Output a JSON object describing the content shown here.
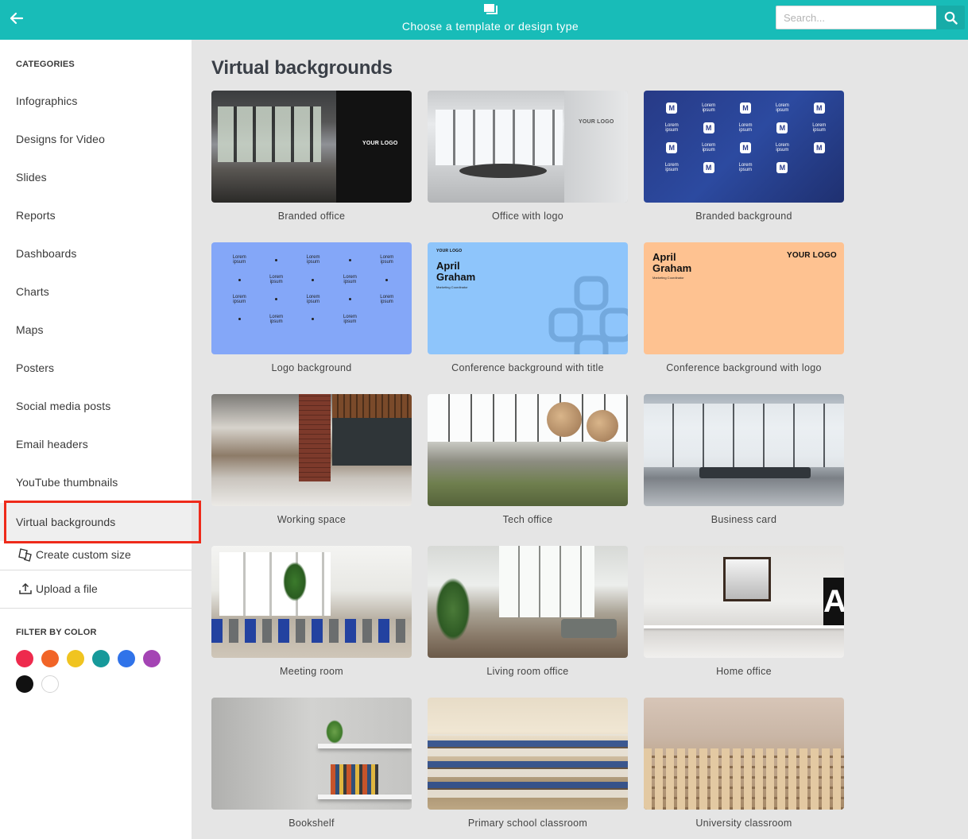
{
  "header": {
    "title": "Choose a template or design type",
    "search_placeholder": "Search..."
  },
  "sidebar": {
    "categories_title": "CATEGORIES",
    "categories": [
      {
        "label": "Infographics"
      },
      {
        "label": "Designs for Video"
      },
      {
        "label": "Slides"
      },
      {
        "label": "Reports"
      },
      {
        "label": "Dashboards"
      },
      {
        "label": "Charts"
      },
      {
        "label": "Maps"
      },
      {
        "label": "Posters"
      },
      {
        "label": "Social media posts"
      },
      {
        "label": "Email headers"
      },
      {
        "label": "YouTube thumbnails"
      },
      {
        "label": "Virtual backgrounds",
        "active": true
      }
    ],
    "actions": {
      "custom_size": "Create custom size",
      "upload": "Upload a file"
    },
    "filter_title": "FILTER BY COLOR",
    "colors": [
      "#ee2a4d",
      "#f16427",
      "#f0c420",
      "#16999a",
      "#3073e9",
      "#a444b4",
      "#111111",
      "#ffffff"
    ]
  },
  "main": {
    "title": "Virtual backgrounds",
    "templates": [
      {
        "label": "Branded office"
      },
      {
        "label": "Office with logo"
      },
      {
        "label": "Branded background"
      },
      {
        "label": "Logo background"
      },
      {
        "label": "Conference background with title"
      },
      {
        "label": "Conference background with logo"
      },
      {
        "label": "Working space"
      },
      {
        "label": "Tech office"
      },
      {
        "label": "Business card"
      },
      {
        "label": "Meeting room"
      },
      {
        "label": "Living room office"
      },
      {
        "label": "Home office"
      },
      {
        "label": "Bookshelf"
      },
      {
        "label": "Primary school classroom"
      },
      {
        "label": "University classroom"
      }
    ],
    "thumb_text": {
      "logo": "YOUR LOGO",
      "lorem_top": "Lorem",
      "lorem_bottom": "ipsum",
      "m_mark": "M",
      "first_name": "April",
      "last_name": "Graham",
      "role": "Marketing Coordinator",
      "letter": "A"
    }
  }
}
